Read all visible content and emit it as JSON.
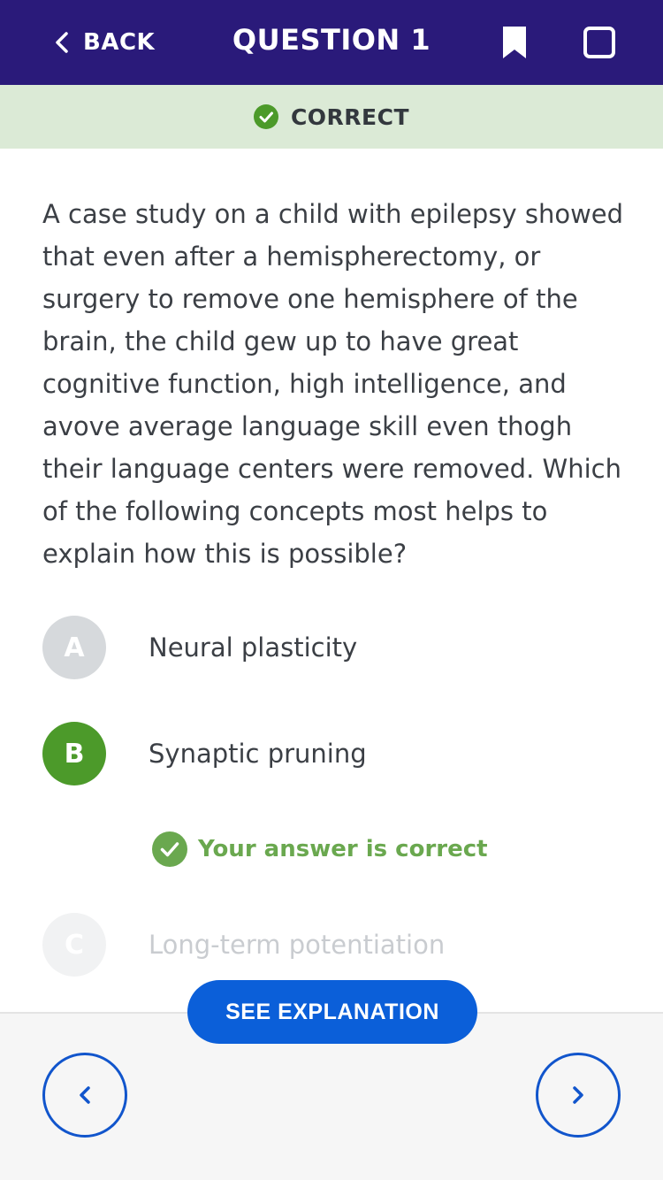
{
  "header": {
    "back_label": "BACK",
    "title": "QUESTION 1"
  },
  "banner": {
    "status_label": "CORRECT"
  },
  "question": {
    "text": "A case study on a child with epilepsy showed that even after a hemispherectomy, or surgery to remove one hemisphere of the brain, the child gew up to have great cognitive function, high intelligence, and avove average language skill even thogh their language centers were removed. Which of the following concepts most helps to explain how this is possible?"
  },
  "options": [
    {
      "letter": "A",
      "text": "Neural plasticity"
    },
    {
      "letter": "B",
      "text": "Synaptic pruning"
    },
    {
      "letter": "C",
      "text": "Long-term potentiation"
    }
  ],
  "feedback": {
    "text": "Your answer is correct"
  },
  "footer": {
    "explanation_label": "SEE EXPLANATION"
  },
  "colors": {
    "header_bg": "#2a1a7a",
    "banner_bg": "#dbead6",
    "correct_green": "#4c9a2a",
    "primary_blue": "#0b5fd9"
  }
}
